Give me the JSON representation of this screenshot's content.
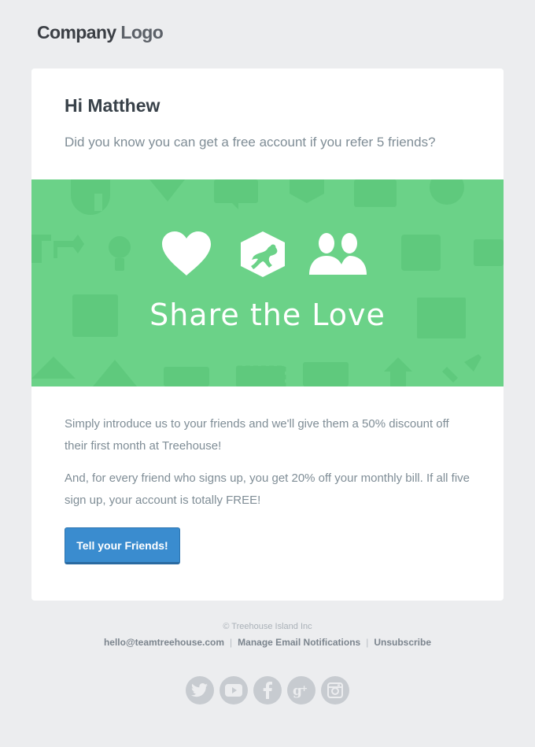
{
  "header": {
    "logo_bold": "Company",
    "logo_light": "Logo"
  },
  "email": {
    "greeting": "Hi Matthew",
    "subline": "Did you know you can get a free account if you refer 5 friends?",
    "banner_title": "Share the Love",
    "banner_icons": [
      "heart-icon",
      "treehouse-frog-icon",
      "friends-icon"
    ],
    "paragraph_1": "Simply introduce us to your friends and we'll give them a 50% discount off their first month at Treehouse!",
    "paragraph_2": "And, for every friend who signs up, you get 20% off your monthly bill. If all five sign up, your account is totally FREE!",
    "cta_label": "Tell your Friends!"
  },
  "footer": {
    "copyright": "© Treehouse Island Inc",
    "email": "hello@teamtreehouse.com",
    "manage": "Manage Email Notifications",
    "unsubscribe": "Unsubscribe",
    "social": [
      "twitter-icon",
      "youtube-icon",
      "facebook-icon",
      "google-plus-icon",
      "instagram-icon"
    ]
  },
  "colors": {
    "background": "#ecedef",
    "banner": "#6bd288",
    "button": "#3a8ccf",
    "text_muted": "#7f8d96",
    "heading": "#384149"
  }
}
